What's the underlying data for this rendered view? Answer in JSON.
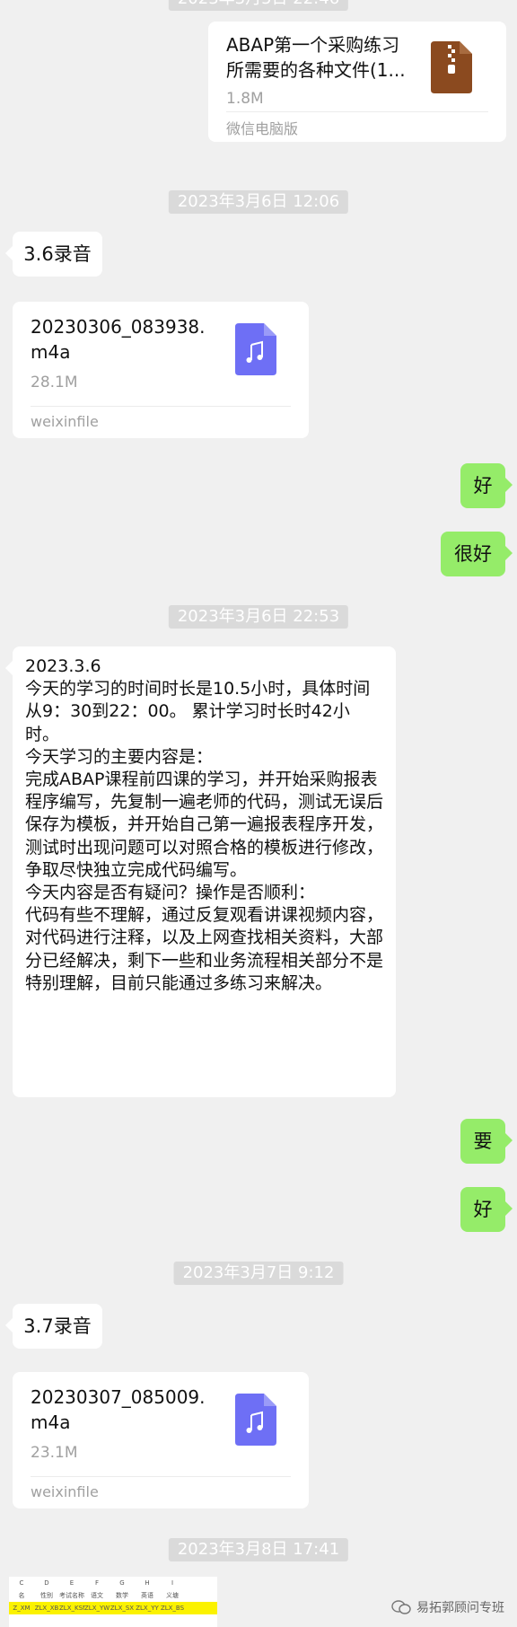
{
  "messages": {
    "file1": {
      "name": "ABAP第一个采购练习所需要的各种文件(1...",
      "size": "1.8M",
      "source": "微信电脑版"
    },
    "ts1": "2023年3月6日 12:06",
    "msg1": "3.6录音",
    "audio1": {
      "name": "20230306_083938.m4a",
      "size": "28.1M",
      "source": "weixinfile"
    },
    "reply1": "好",
    "reply2": "很好",
    "ts2": "2023年3月6日 22:53",
    "report": "2023.3.6\n今天的学习的时间时长是10.5小时，具体时间从9：30到22：00。 累计学习时长时42小时。\n今天学习的主要内容是：\n完成ABAP课程前四课的学习，并开始采购报表程序编写，先复制一遍老师的代码，测试无误后保存为模板，并开始自己第一遍报表程序开发，测试时出现问题可以对照合格的模板进行修改，争取尽快独立完成代码编写。\n今天内容是否有疑问？操作是否顺利：\n代码有些不理解，通过反复观看讲课视频内容，对代码进行注释，以及上网查找相关资料，大部分已经解决，剩下一些和业务流程相关部分不是特别理解，目前只能通过多练习来解决。",
    "reply3": "要",
    "reply4": "好",
    "ts3": "2023年3月7日 9:12",
    "msg2": "3.7录音",
    "audio2": {
      "name": "20230307_085009.m4a",
      "size": "23.1M",
      "source": "weixinfile"
    },
    "ts4": "2023年3月8日 17:41"
  },
  "spreadsheet": {
    "col_letters": [
      "C",
      "D",
      "E",
      "F",
      "G",
      "H",
      "I"
    ],
    "headers": [
      "名",
      "性别",
      "考试名称",
      "语文",
      "数学",
      "英语",
      "义塘"
    ],
    "field_row": [
      "Z_XM",
      "ZLX_XB",
      "ZLX_KSMC",
      "ZLX_YW",
      "ZLX_SX",
      "ZLX_YY",
      "ZLX_BS"
    ]
  },
  "watermark": "易拓郭顾问专班",
  "colors": {
    "chat_bg": "#f0f0f0",
    "self_bubble": "#95ec69",
    "audio_icon": "#6e6ff5",
    "zip_icon": "#8b4a1f"
  }
}
